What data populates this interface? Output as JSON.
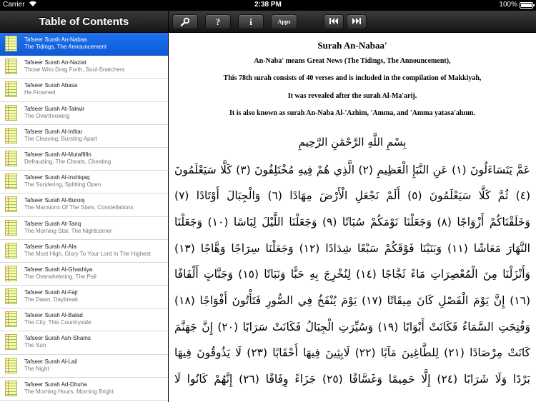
{
  "status_bar": {
    "carrier": "Carrier",
    "time": "2:38 PM",
    "battery": "100%"
  },
  "sidebar": {
    "title": "Table of Contents",
    "items": [
      {
        "title": "Tafseer Surah An-Nabaa",
        "subtitle": "The Tidings, The Announcement",
        "selected": true
      },
      {
        "title": "Tafseer Surah An-Naziat",
        "subtitle": "Those Who Drag Forth, Soul-Snatchers"
      },
      {
        "title": "Tafseer Surah Abasa",
        "subtitle": "He Frowned"
      },
      {
        "title": "Tafseer Surah At-Takwir",
        "subtitle": "The Overthrowing"
      },
      {
        "title": "Tafseer Surah Al-Infitar",
        "subtitle": "The Cleaving, Bursting Apart"
      },
      {
        "title": "Tafseer Surah Al-Mutaffifin",
        "subtitle": "Defrauding, The Cheats, Cheating"
      },
      {
        "title": "Tafseer Surah Al-Inshiqaq",
        "subtitle": "The Sundering, Splitting Open"
      },
      {
        "title": "Tafseer Surah Al-Burooj",
        "subtitle": "The Mansions Of The Stars, Constellations"
      },
      {
        "title": "Tafseer Surah At-Tariq",
        "subtitle": "The Morning Star, The Nightcomer"
      },
      {
        "title": "Tafseer Surah Al-Ala",
        "subtitle": "The Most High, Glory To Your Lord In The Highest"
      },
      {
        "title": "Tafseer Surah Al-Ghashiya",
        "subtitle": "The Overwhelming, The Pall"
      },
      {
        "title": "Tafseer Surah Al-Fajr",
        "subtitle": "The Dawn, Daybreak"
      },
      {
        "title": "Tafseer Surah Al-Balad",
        "subtitle": "The City, This Countryside"
      },
      {
        "title": "Tafseer Surah Ash-Shams",
        "subtitle": "The Sun"
      },
      {
        "title": "Tafseer Surah Al-Lail",
        "subtitle": "The Night"
      },
      {
        "title": "Tafseer Surah Ad-Dhuha",
        "subtitle": "The Morning Hours, Morning Bright"
      }
    ]
  },
  "toolbar": {
    "help_label": "?",
    "info_label": "i",
    "apps_label": "Apps",
    "search_icon": "search-icon",
    "prev_icon": "skip-back-icon",
    "next_icon": "skip-forward-icon"
  },
  "content": {
    "title": "Surah An-Nabaa'",
    "intro_lines": [
      "An-Naba' means Great News (The Tidings, The Announcement),",
      "This 78th surah consists of 40 verses and is included in the compilation of Makkiyah,",
      "It was revealed after the surah Al-Ma'arij.",
      "It is also known as surah An-Naba Al-'Azhim, 'Amma, and 'Amma yatasa'aluun."
    ],
    "basmala": "بِسْمِ اللَّهِ الرَّحْمَٰنِ الرَّحِيمِ",
    "arabic_lines": [
      "عَمَّ يَتَسَاءَلُونَ (١) عَنِ النَّبَإِ الْعَظِيمِ (٢) الَّذِي هُمْ فِيهِ مُخْتَلِفُونَ (٣) كَلَّا سَيَعْلَمُونَ",
      "(٤) ثُمَّ كَلَّا سَيَعْلَمُونَ (٥) أَلَمْ نَجْعَلِ الْأَرْضَ مِهَادًا (٦) وَالْجِبَالَ أَوْتَادًا (٧)",
      "وَخَلَقْنَاكُمْ أَزْوَاجًا (٨) وَجَعَلْنَا نَوْمَكُمْ سُبَاتًا (٩) وَجَعَلْنَا اللَّيْلَ لِبَاسًا (١٠) وَجَعَلْنَا",
      "النَّهَارَ مَعَاشًا (١١) وَبَنَيْنَا فَوْقَكُمْ سَبْعًا شِدَادًا (١٢) وَجَعَلْنَا سِرَاجًا وَهَّاجًا (١٣)",
      "وَأَنْزَلْنَا مِنَ الْمُعْصِرَاتِ مَاءً ثَجَّاجًا (١٤) لِنُخْرِجَ بِهِ حَبًّا وَنَبَاتًا (١٥) وَجَنَّاتٍ أَلْفَافًا",
      "(١٦) إِنَّ يَوْمَ الْفَصْلِ كَانَ مِيقَاتًا (١٧) يَوْمَ يُنْفَخُ فِي الصُّورِ فَتَأْتُونَ أَفْوَاجًا (١٨)",
      "وَفُتِحَتِ السَّمَاءُ فَكَانَتْ أَبْوَابًا (١٩) وَسُيِّرَتِ الْجِبَالُ فَكَانَتْ سَرَابًا (٢٠) إِنَّ جَهَنَّمَ",
      "كَانَتْ مِرْصَادًا (٢١) لِلطَّاغِينَ مَآبًا (٢٢) لَابِثِينَ فِيهَا أَحْقَابًا (٢٣) لَا يَذُوقُونَ فِيهَا",
      "بَرْدًا وَلَا شَرَابًا (٢٤) إِلَّا حَمِيمًا وَغَسَّاقًا (٢٥) جَزَاءً وِفَاقًا (٢٦) إِنَّهُمْ كَانُوا لَا"
    ]
  }
}
